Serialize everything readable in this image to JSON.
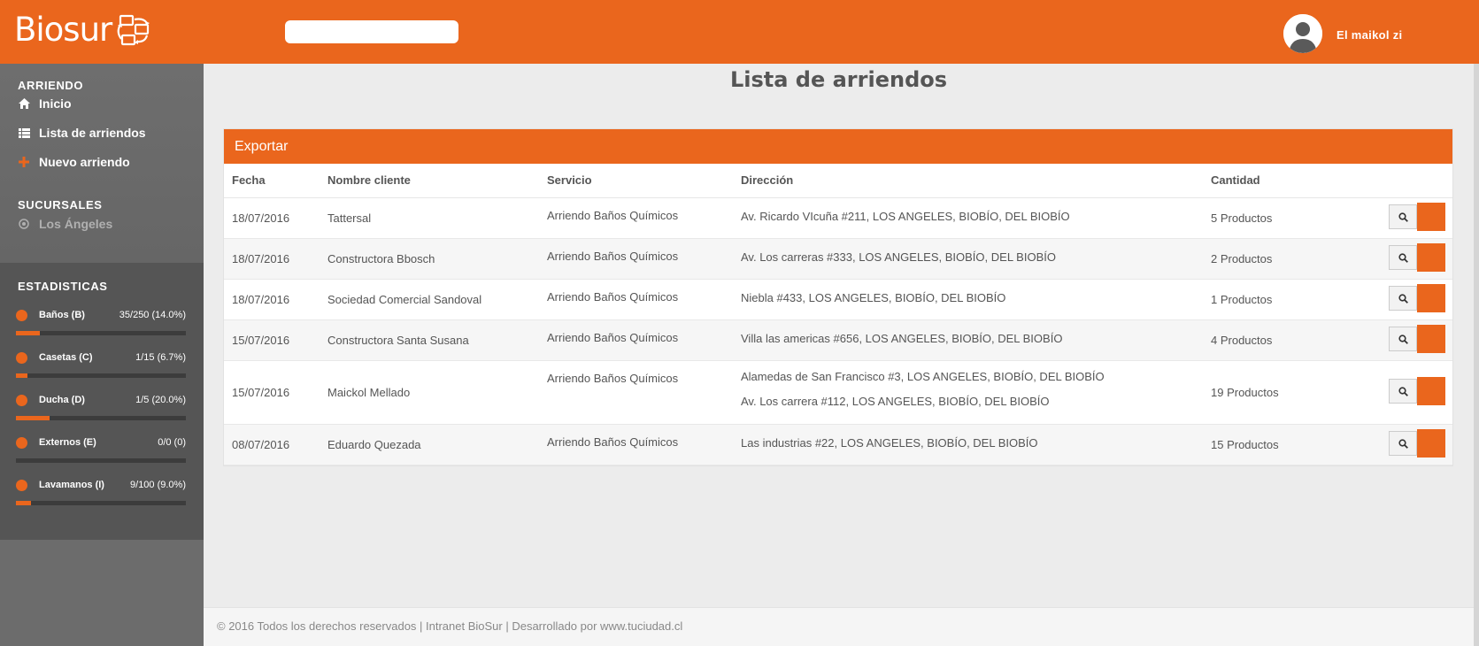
{
  "brand": {
    "name": "Biosur",
    "accent": "#ea661d"
  },
  "header": {
    "search_value": "",
    "user_name": "El maikol zi"
  },
  "sidebar": {
    "section_arriendo": "ARRIENDO",
    "arriendo_items": [
      {
        "label": "Inicio",
        "icon": "home-icon"
      },
      {
        "label": "Lista de arriendos",
        "icon": "list-icon"
      },
      {
        "label": "Nuevo arriendo",
        "icon": "plus-icon"
      }
    ],
    "section_sucursales": "SUCURSALES",
    "sucursal_items": [
      {
        "label": "Los Ángeles",
        "icon": "radio-icon"
      }
    ],
    "section_estadisticas": "ESTADISTICAS",
    "stats": [
      {
        "label": "Baños (B)",
        "value": "35/250 (14.0%)",
        "fraction": 0.14
      },
      {
        "label": "Casetas (C)",
        "value": "1/15 (6.7%)",
        "fraction": 0.067
      },
      {
        "label": "Ducha (D)",
        "value": "1/5 (20.0%)",
        "fraction": 0.2
      },
      {
        "label": "Externos (E)",
        "value": "0/0 (0)",
        "fraction": 0
      },
      {
        "label": "Lavamanos (I)",
        "value": "9/100 (9.0%)",
        "fraction": 0.09
      }
    ]
  },
  "main": {
    "title": "Lista de arriendos",
    "export_label": "Exportar",
    "columns": [
      "Fecha",
      "Nombre cliente",
      "Servicio",
      "Dirección",
      "Cantidad"
    ],
    "rows": [
      {
        "fecha": "18/07/2016",
        "cliente": "Tattersal",
        "servicio": "Arriendo Baños Químicos",
        "direcciones": [
          "Av. Ricardo VIcuña #211, LOS ANGELES, BIOBÍO, DEL BIOBÍO"
        ],
        "cantidad": "5 Productos"
      },
      {
        "fecha": "18/07/2016",
        "cliente": "Constructora Bbosch",
        "servicio": "Arriendo Baños Químicos",
        "direcciones": [
          "Av. Los carreras #333, LOS ANGELES, BIOBÍO, DEL BIOBÍO"
        ],
        "cantidad": "2 Productos"
      },
      {
        "fecha": "18/07/2016",
        "cliente": "Sociedad Comercial Sandoval",
        "servicio": "Arriendo Baños Químicos",
        "direcciones": [
          "Niebla #433, LOS ANGELES, BIOBÍO, DEL BIOBÍO"
        ],
        "cantidad": "1 Productos"
      },
      {
        "fecha": "15/07/2016",
        "cliente": "Constructora Santa Susana",
        "servicio": "Arriendo Baños Químicos",
        "direcciones": [
          "Villa las americas #656, LOS ANGELES, BIOBÍO, DEL BIOBÍO"
        ],
        "cantidad": "4 Productos"
      },
      {
        "fecha": "15/07/2016",
        "cliente": "Maickol Mellado",
        "servicio": "Arriendo Baños Químicos",
        "direcciones": [
          "Alamedas de San Francisco #3, LOS ANGELES, BIOBÍO, DEL BIOBÍO",
          "Av. Los carrera #112, LOS ANGELES, BIOBÍO, DEL BIOBÍO"
        ],
        "cantidad": "19 Productos"
      },
      {
        "fecha": "08/07/2016",
        "cliente": "Eduardo Quezada",
        "servicio": "Arriendo Baños Químicos",
        "direcciones": [
          "Las industrias #22, LOS ANGELES, BIOBÍO, DEL BIOBÍO"
        ],
        "cantidad": "15 Productos"
      }
    ]
  },
  "footer": {
    "text": "© 2016 Todos los derechos reservados | Intranet BioSur | Desarrollado por www.tuciudad.cl"
  }
}
